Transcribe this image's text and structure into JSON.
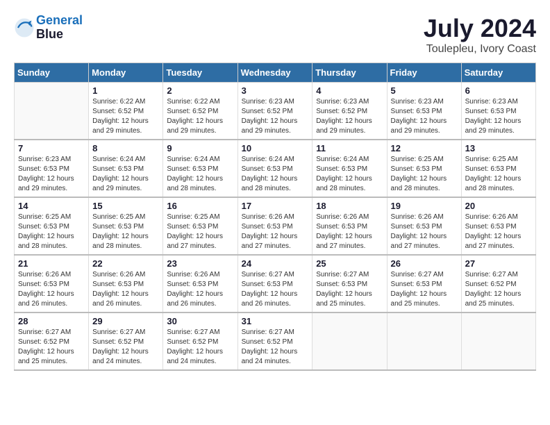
{
  "header": {
    "logo_line1": "General",
    "logo_line2": "Blue",
    "month": "July 2024",
    "location": "Toulepleu, Ivory Coast"
  },
  "days_of_week": [
    "Sunday",
    "Monday",
    "Tuesday",
    "Wednesday",
    "Thursday",
    "Friday",
    "Saturday"
  ],
  "weeks": [
    [
      {
        "day": "",
        "info": ""
      },
      {
        "day": "1",
        "info": "Sunrise: 6:22 AM\nSunset: 6:52 PM\nDaylight: 12 hours\nand 29 minutes."
      },
      {
        "day": "2",
        "info": "Sunrise: 6:22 AM\nSunset: 6:52 PM\nDaylight: 12 hours\nand 29 minutes."
      },
      {
        "day": "3",
        "info": "Sunrise: 6:23 AM\nSunset: 6:52 PM\nDaylight: 12 hours\nand 29 minutes."
      },
      {
        "day": "4",
        "info": "Sunrise: 6:23 AM\nSunset: 6:52 PM\nDaylight: 12 hours\nand 29 minutes."
      },
      {
        "day": "5",
        "info": "Sunrise: 6:23 AM\nSunset: 6:53 PM\nDaylight: 12 hours\nand 29 minutes."
      },
      {
        "day": "6",
        "info": "Sunrise: 6:23 AM\nSunset: 6:53 PM\nDaylight: 12 hours\nand 29 minutes."
      }
    ],
    [
      {
        "day": "7",
        "info": "Sunrise: 6:23 AM\nSunset: 6:53 PM\nDaylight: 12 hours\nand 29 minutes."
      },
      {
        "day": "8",
        "info": "Sunrise: 6:24 AM\nSunset: 6:53 PM\nDaylight: 12 hours\nand 29 minutes."
      },
      {
        "day": "9",
        "info": "Sunrise: 6:24 AM\nSunset: 6:53 PM\nDaylight: 12 hours\nand 28 minutes."
      },
      {
        "day": "10",
        "info": "Sunrise: 6:24 AM\nSunset: 6:53 PM\nDaylight: 12 hours\nand 28 minutes."
      },
      {
        "day": "11",
        "info": "Sunrise: 6:24 AM\nSunset: 6:53 PM\nDaylight: 12 hours\nand 28 minutes."
      },
      {
        "day": "12",
        "info": "Sunrise: 6:25 AM\nSunset: 6:53 PM\nDaylight: 12 hours\nand 28 minutes."
      },
      {
        "day": "13",
        "info": "Sunrise: 6:25 AM\nSunset: 6:53 PM\nDaylight: 12 hours\nand 28 minutes."
      }
    ],
    [
      {
        "day": "14",
        "info": "Sunrise: 6:25 AM\nSunset: 6:53 PM\nDaylight: 12 hours\nand 28 minutes."
      },
      {
        "day": "15",
        "info": "Sunrise: 6:25 AM\nSunset: 6:53 PM\nDaylight: 12 hours\nand 28 minutes."
      },
      {
        "day": "16",
        "info": "Sunrise: 6:25 AM\nSunset: 6:53 PM\nDaylight: 12 hours\nand 27 minutes."
      },
      {
        "day": "17",
        "info": "Sunrise: 6:26 AM\nSunset: 6:53 PM\nDaylight: 12 hours\nand 27 minutes."
      },
      {
        "day": "18",
        "info": "Sunrise: 6:26 AM\nSunset: 6:53 PM\nDaylight: 12 hours\nand 27 minutes."
      },
      {
        "day": "19",
        "info": "Sunrise: 6:26 AM\nSunset: 6:53 PM\nDaylight: 12 hours\nand 27 minutes."
      },
      {
        "day": "20",
        "info": "Sunrise: 6:26 AM\nSunset: 6:53 PM\nDaylight: 12 hours\nand 27 minutes."
      }
    ],
    [
      {
        "day": "21",
        "info": "Sunrise: 6:26 AM\nSunset: 6:53 PM\nDaylight: 12 hours\nand 26 minutes."
      },
      {
        "day": "22",
        "info": "Sunrise: 6:26 AM\nSunset: 6:53 PM\nDaylight: 12 hours\nand 26 minutes."
      },
      {
        "day": "23",
        "info": "Sunrise: 6:26 AM\nSunset: 6:53 PM\nDaylight: 12 hours\nand 26 minutes."
      },
      {
        "day": "24",
        "info": "Sunrise: 6:27 AM\nSunset: 6:53 PM\nDaylight: 12 hours\nand 26 minutes."
      },
      {
        "day": "25",
        "info": "Sunrise: 6:27 AM\nSunset: 6:53 PM\nDaylight: 12 hours\nand 25 minutes."
      },
      {
        "day": "26",
        "info": "Sunrise: 6:27 AM\nSunset: 6:53 PM\nDaylight: 12 hours\nand 25 minutes."
      },
      {
        "day": "27",
        "info": "Sunrise: 6:27 AM\nSunset: 6:52 PM\nDaylight: 12 hours\nand 25 minutes."
      }
    ],
    [
      {
        "day": "28",
        "info": "Sunrise: 6:27 AM\nSunset: 6:52 PM\nDaylight: 12 hours\nand 25 minutes."
      },
      {
        "day": "29",
        "info": "Sunrise: 6:27 AM\nSunset: 6:52 PM\nDaylight: 12 hours\nand 24 minutes."
      },
      {
        "day": "30",
        "info": "Sunrise: 6:27 AM\nSunset: 6:52 PM\nDaylight: 12 hours\nand 24 minutes."
      },
      {
        "day": "31",
        "info": "Sunrise: 6:27 AM\nSunset: 6:52 PM\nDaylight: 12 hours\nand 24 minutes."
      },
      {
        "day": "",
        "info": ""
      },
      {
        "day": "",
        "info": ""
      },
      {
        "day": "",
        "info": ""
      }
    ]
  ]
}
